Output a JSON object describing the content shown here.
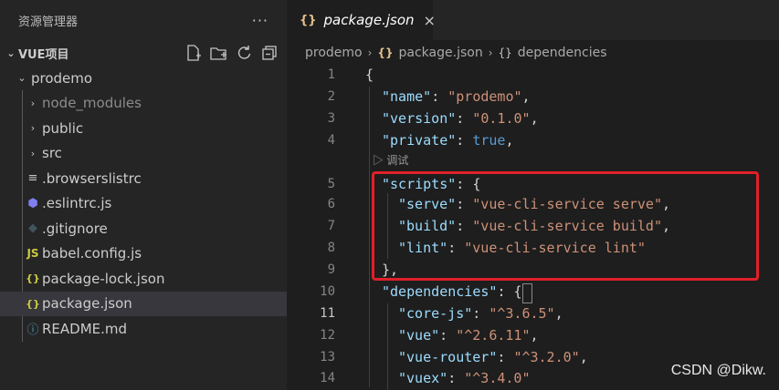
{
  "explorer": {
    "title": "资源管理器",
    "more": "···",
    "section_title": "VUE项目",
    "section_chevron": "⌄",
    "actions": [
      "new-file-icon",
      "new-folder-icon",
      "refresh-icon",
      "collapse-all-icon"
    ],
    "root_folder": "prodemo",
    "items": [
      {
        "label": "node_modules",
        "type": "folder"
      },
      {
        "label": "public",
        "type": "folder"
      },
      {
        "label": "src",
        "type": "folder"
      },
      {
        "label": ".browserslistrc",
        "type": "file"
      },
      {
        "label": ".eslintrc.js",
        "type": "file"
      },
      {
        "label": ".gitignore",
        "type": "file"
      },
      {
        "label": "babel.config.js",
        "type": "file"
      },
      {
        "label": "package-lock.json",
        "type": "file"
      },
      {
        "label": "package.json",
        "type": "file"
      },
      {
        "label": "README.md",
        "type": "file"
      }
    ]
  },
  "tab": {
    "brace": "{}",
    "label": "package.json",
    "close": "×"
  },
  "breadcrumb": {
    "root": "prodemo",
    "file": "package.json",
    "node": "dependencies",
    "brace": "{}"
  },
  "codelens": "▷ 调试",
  "line_numbers": [
    "1",
    "2",
    "3",
    "4",
    "5",
    "6",
    "7",
    "8",
    "9",
    "10",
    "11",
    "12",
    "13",
    "14"
  ],
  "code": {
    "l1": "{",
    "l2_key": "\"name\"",
    "l2_val": "\"prodemo\"",
    "l3_key": "\"version\"",
    "l3_val": "\"0.1.0\"",
    "l4_key": "\"private\"",
    "l4_val": "true",
    "l5_key": "\"scripts\"",
    "l6_key": "\"serve\"",
    "l6_val": "\"vue-cli-service serve\"",
    "l7_key": "\"build\"",
    "l7_val": "\"vue-cli-service build\"",
    "l8_key": "\"lint\"",
    "l8_val": "\"vue-cli-service lint\"",
    "l9": "},",
    "l10_key": "\"dependencies\"",
    "l11_key": "\"core-js\"",
    "l11_val": "\"^3.6.5\"",
    "l12_key": "\"vue\"",
    "l12_val": "\"^2.6.11\"",
    "l13_key": "\"vue-router\"",
    "l13_val": "\"^3.2.0\"",
    "l14_key": "\"vuex\"",
    "l14_val": "\"^3.4.0\""
  },
  "watermark": "CSDN @Dikw."
}
